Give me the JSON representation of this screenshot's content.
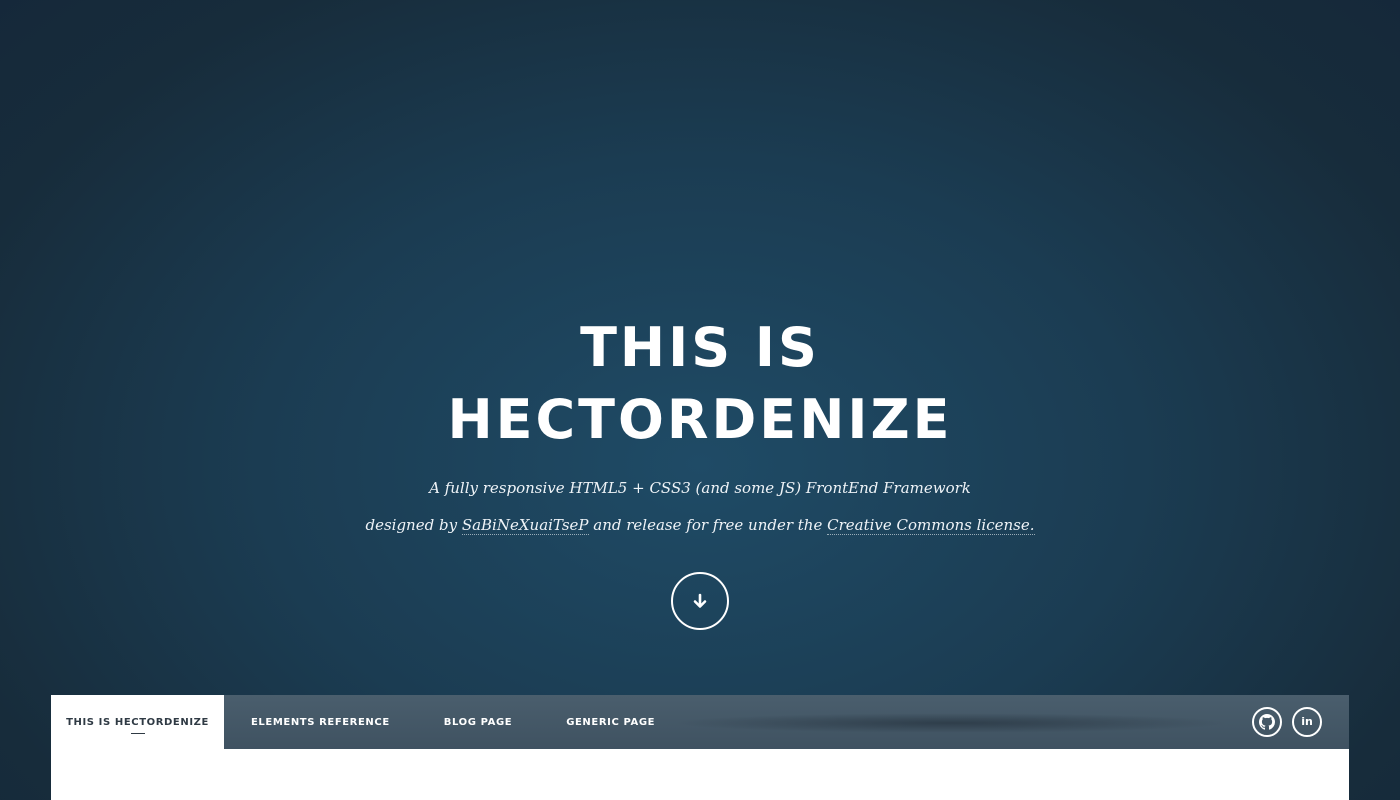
{
  "hero": {
    "title_line1": "THIS IS",
    "title_line2": "HECTORDENIZE",
    "tagline_line1": "A fully responsive HTML5 + CSS3 (and some JS) FrontEnd Framework",
    "tagline_line2_prefix": "designed by ",
    "author_link": "SaBiNeXuaiTseP",
    "tagline_line2_middle": " and release for free under the ",
    "license_link": "Creative Commons license."
  },
  "scroll_button": {
    "icon": "arrow-down-icon"
  },
  "nav": {
    "items": [
      {
        "label": "THIS IS HECTORDENIZE",
        "active": true
      },
      {
        "label": "ELEMENTS REFERENCE",
        "active": false
      },
      {
        "label": "BLOG PAGE",
        "active": false
      },
      {
        "label": "GENERIC PAGE",
        "active": false
      }
    ],
    "social": [
      {
        "icon": "github-icon"
      },
      {
        "icon": "linkedin-icon",
        "text": "in"
      }
    ]
  },
  "colors": {
    "background": "#1b3c52",
    "nav_bar": "#45596a",
    "text": "#ffffff",
    "active_tab_text": "#2f3a44"
  }
}
